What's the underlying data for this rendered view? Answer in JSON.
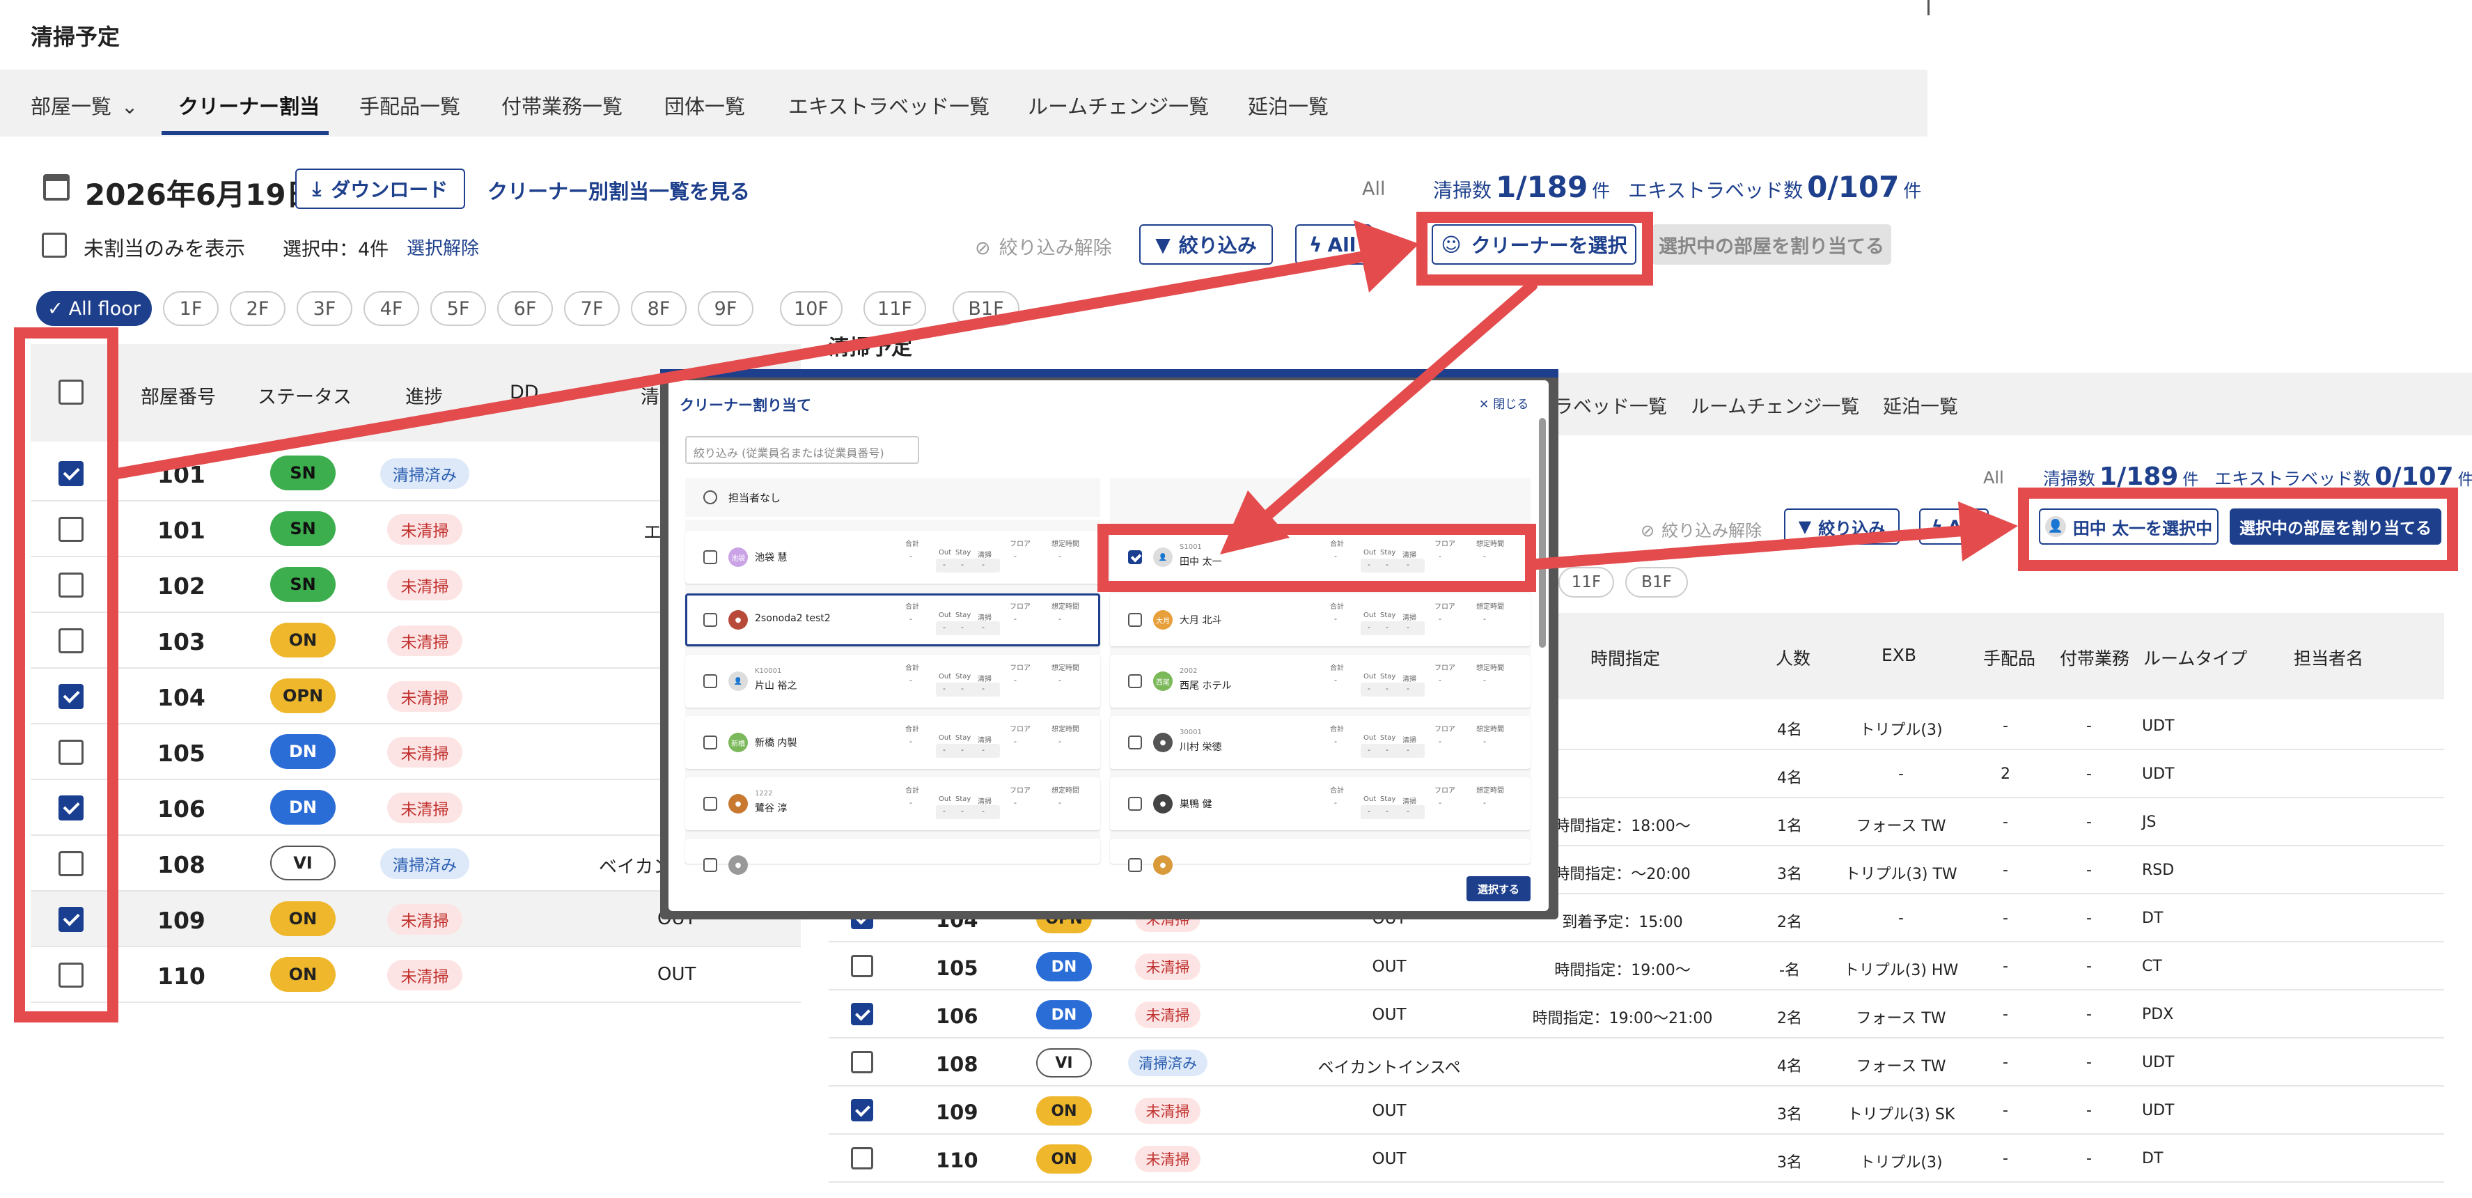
{
  "page": {
    "title": "清掃予定"
  },
  "tabs": [
    {
      "label": "部屋一覧"
    },
    {
      "label": "クリーナー割当"
    },
    {
      "label": "手配品一覧"
    },
    {
      "label": "付帯業務一覧"
    },
    {
      "label": "団体一覧"
    },
    {
      "label": "エキストラベッド一覧"
    },
    {
      "label": "ルームチェンジ一覧"
    },
    {
      "label": "延泊一覧"
    }
  ],
  "toolbar": {
    "date": "2026年6月19日",
    "download": "ダウンロード",
    "list_link": "クリーナー別割当一覧を見る",
    "all": "All",
    "clean_label": "清掃数",
    "clean_value": "1/189",
    "clean_unit": "件",
    "exb_label": "エキストラベッド数",
    "exb_value": "0/107",
    "exb_unit": "件",
    "unassigned_only": "未割当のみを表示",
    "selected": "選択中：4件",
    "clear_selection": "選択解除",
    "filter_clear": "絞り込み解除",
    "filter": "絞り込み",
    "auto": "All",
    "select_cleaner": "クリーナーを選択",
    "assign_rooms": "選択中の部屋を割り当てる"
  },
  "floors": [
    "All floor",
    "1F",
    "2F",
    "3F",
    "4F",
    "5F",
    "6F",
    "7F",
    "8F",
    "9F",
    "10F",
    "11F",
    "B1F"
  ],
  "table_left": {
    "headers": [
      "部屋番号",
      "ステータス",
      "進捗",
      "DD",
      "清"
    ],
    "rows": [
      {
        "checked": true,
        "room": "101",
        "status": "SN",
        "status_kind": "sn",
        "progress": "清掃済み",
        "progress_kind": "done",
        "extra": ""
      },
      {
        "checked": false,
        "room": "101",
        "status": "SN",
        "status_kind": "sn",
        "progress": "未清掃",
        "progress_kind": "not",
        "extra": "エ"
      },
      {
        "checked": false,
        "room": "102",
        "status": "SN",
        "status_kind": "sn",
        "progress": "未清掃",
        "progress_kind": "not",
        "extra": ""
      },
      {
        "checked": false,
        "room": "103",
        "status": "ON",
        "status_kind": "on",
        "progress": "未清掃",
        "progress_kind": "not",
        "extra": ""
      },
      {
        "checked": true,
        "room": "104",
        "status": "OPN",
        "status_kind": "on",
        "progress": "未清掃",
        "progress_kind": "not",
        "extra": ""
      },
      {
        "checked": false,
        "room": "105",
        "status": "DN",
        "status_kind": "dn",
        "progress": "未清掃",
        "progress_kind": "not",
        "extra": ""
      },
      {
        "checked": true,
        "room": "106",
        "status": "DN",
        "status_kind": "dn",
        "progress": "未清掃",
        "progress_kind": "not",
        "extra": ""
      },
      {
        "checked": false,
        "room": "108",
        "status": "VI",
        "status_kind": "vi",
        "progress": "清掃済み",
        "progress_kind": "done",
        "extra": "ベイカン"
      },
      {
        "checked": true,
        "room": "109",
        "status": "ON",
        "status_kind": "on",
        "progress": "未清掃",
        "progress_kind": "not",
        "extra": "OUT"
      },
      {
        "checked": false,
        "room": "110",
        "status": "ON",
        "status_kind": "on",
        "progress": "未清掃",
        "progress_kind": "not",
        "extra": "OUT"
      }
    ]
  },
  "right_panel": {
    "title": "清掃予定",
    "tabs": [
      "ラベッド一覧",
      "ルームチェンジ一覧",
      "延泊一覧"
    ],
    "all": "All",
    "clean_label": "清掃数",
    "clean_value": "1/189",
    "clean_unit": "件",
    "exb_label": "エキストラベッド数",
    "exb_value": "0/107",
    "exb_unit": "件",
    "filter_clear": "絞り込み解除",
    "filter": "絞り込み",
    "auto": "All",
    "selected_cleaner": "田中 太一を選択中",
    "assign_rooms": "選択中の部屋を割り当てる",
    "floors": [
      "11F",
      "B1F"
    ],
    "headers": [
      "時間指定",
      "人数",
      "EXB",
      "手配品",
      "付帯業務",
      "ルームタイプ",
      "担当者名"
    ],
    "rows": [
      {
        "checked": null,
        "room": "",
        "status": "",
        "status_kind": "",
        "progress": "",
        "progress_kind": "",
        "clean": "",
        "time": "",
        "people": "4名",
        "exb": "トリプル(3)",
        "items": "-",
        "extra": "-",
        "type": "UDT"
      },
      {
        "checked": null,
        "room": "",
        "status": "",
        "status_kind": "",
        "progress": "",
        "progress_kind": "",
        "clean": "",
        "time": "",
        "people": "4名",
        "exb": "-",
        "items": "2",
        "extra": "-",
        "type": "UDT"
      },
      {
        "checked": null,
        "room": "",
        "status": "",
        "status_kind": "",
        "progress": "",
        "progress_kind": "",
        "clean": "",
        "time": "時間指定：18:00〜",
        "people": "1名",
        "exb": "フォース TW",
        "items": "-",
        "extra": "-",
        "type": "JS"
      },
      {
        "checked": null,
        "room": "",
        "status": "",
        "status_kind": "",
        "progress": "",
        "progress_kind": "",
        "clean": "",
        "time": "時間指定：〜20:00",
        "people": "3名",
        "exb": "トリプル(3) TW",
        "items": "-",
        "extra": "-",
        "type": "RSD"
      },
      {
        "checked": true,
        "room": "104",
        "status": "OPN",
        "status_kind": "on",
        "progress": "未清掃",
        "progress_kind": "not",
        "clean": "OUT",
        "time": "到着予定：15:00",
        "people": "2名",
        "exb": "-",
        "items": "-",
        "extra": "-",
        "type": "DT"
      },
      {
        "checked": false,
        "room": "105",
        "status": "DN",
        "status_kind": "dn",
        "progress": "未清掃",
        "progress_kind": "not",
        "clean": "OUT",
        "time": "時間指定：19:00〜",
        "people": "-名",
        "exb": "トリプル(3) HW",
        "items": "-",
        "extra": "-",
        "type": "CT"
      },
      {
        "checked": true,
        "room": "106",
        "status": "DN",
        "status_kind": "dn",
        "progress": "未清掃",
        "progress_kind": "not",
        "clean": "OUT",
        "time": "時間指定：19:00〜21:00",
        "people": "2名",
        "exb": "フォース TW",
        "items": "-",
        "extra": "-",
        "type": "PDX"
      },
      {
        "checked": false,
        "room": "108",
        "status": "VI",
        "status_kind": "vi",
        "progress": "清掃済み",
        "progress_kind": "done",
        "clean": "ベイカントインスペ",
        "time": "",
        "people": "4名",
        "exb": "フォース TW",
        "items": "-",
        "extra": "-",
        "type": "UDT"
      },
      {
        "checked": true,
        "room": "109",
        "status": "ON",
        "status_kind": "on",
        "progress": "未清掃",
        "progress_kind": "not",
        "clean": "OUT",
        "time": "",
        "people": "3名",
        "exb": "トリプル(3) SK",
        "items": "-",
        "extra": "-",
        "type": "UDT"
      },
      {
        "checked": false,
        "room": "110",
        "status": "ON",
        "status_kind": "on",
        "progress": "未清掃",
        "progress_kind": "not",
        "clean": "OUT",
        "time": "",
        "people": "3名",
        "exb": "トリプル(3)",
        "items": "-",
        "extra": "-",
        "type": "DT"
      }
    ]
  },
  "modal": {
    "title": "クリーナー割り当て",
    "close": "閉じる",
    "search_placeholder": "絞り込み (従業員名または従業員番号)",
    "none": "担当者なし",
    "stat_labels": {
      "total": "合計",
      "out": "Out",
      "stay": "Stay",
      "clean": "清掃",
      "floor": "フロア",
      "time": "想定時間"
    },
    "dash": "-",
    "cleaners": [
      {
        "id": "",
        "name": "池袋 慧",
        "avatar": "池袋",
        "avatar_color": "#c9a3e6",
        "checked": false,
        "outlined": false
      },
      {
        "id": "S1001",
        "name": "田中 太一",
        "avatar": "👤",
        "avatar_color": "#ddd",
        "checked": true,
        "outlined": false
      },
      {
        "id": "",
        "name": "2sonoda2 test2",
        "avatar": "●",
        "avatar_color": "#b84a3a",
        "checked": false,
        "outlined": true
      },
      {
        "id": "",
        "name": "大月 北斗",
        "avatar": "大月",
        "avatar_color": "#e8a03c",
        "checked": false,
        "outlined": false
      },
      {
        "id": "K10001",
        "name": "片山 裕之",
        "avatar": "👤",
        "avatar_color": "#ddd",
        "checked": false,
        "outlined": false
      },
      {
        "id": "2002",
        "name": "西尾 ホテル",
        "avatar": "西尾",
        "avatar_color": "#7ab85a",
        "checked": false,
        "outlined": false
      },
      {
        "id": "",
        "name": "新橋 内製",
        "avatar": "新橋",
        "avatar_color": "#7ab85a",
        "checked": false,
        "outlined": false
      },
      {
        "id": "30001",
        "name": "川村 栄徳",
        "avatar": "●",
        "avatar_color": "#555",
        "checked": false,
        "outlined": false
      },
      {
        "id": "1222",
        "name": "鷺谷 淳",
        "avatar": "●",
        "avatar_color": "#c8792f",
        "checked": false,
        "outlined": false
      },
      {
        "id": "",
        "name": "巣鴨 健",
        "avatar": "●",
        "avatar_color": "#444",
        "checked": false,
        "outlined": false
      },
      {
        "id": "",
        "name": "",
        "avatar": "●",
        "avatar_color": "#999",
        "checked": false,
        "outlined": false
      },
      {
        "id": "",
        "name": "",
        "avatar": "●",
        "avatar_color": "#d99a3a",
        "checked": false,
        "outlined": false
      }
    ],
    "select_button": "選択する"
  },
  "colors": {
    "accent": "#1d3f8c",
    "highlight": "#e34b4d",
    "header_bg": "#f1f1f1"
  }
}
